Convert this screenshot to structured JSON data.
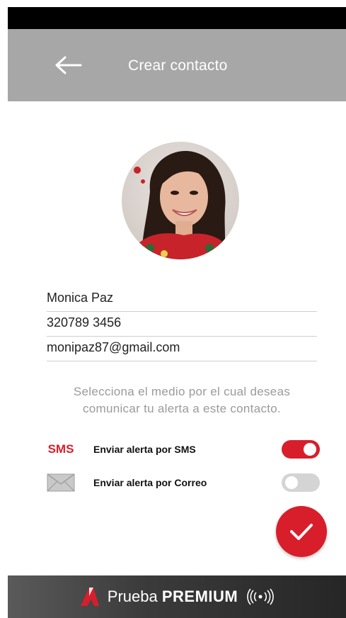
{
  "app_bar": {
    "title": "Crear contacto",
    "back_icon": "arrow-left-icon"
  },
  "contact": {
    "name": "Monica Paz",
    "phone": "320789 3456",
    "email": "monipaz87@gmail.com"
  },
  "instructions": {
    "line1": "Selecciona el medio por el cual deseas",
    "line2": "comunicar tu alerta a este contacto."
  },
  "options": {
    "sms": {
      "icon_label": "SMS",
      "label": "Enviar alerta por SMS",
      "enabled": true
    },
    "email": {
      "icon": "envelope-icon",
      "label": "Enviar alerta por Correo",
      "enabled": false
    }
  },
  "save_button": {
    "icon": "checkmark-icon"
  },
  "premium_banner": {
    "prefix": "Prueba",
    "highlight": "PREMIUM",
    "icons": [
      "brand-logo-icon",
      "signal-icon"
    ]
  },
  "colors": {
    "accent": "#d81e2b",
    "app_bar": "#a7a7a7",
    "toggle_off": "#d4d4d4",
    "status_bar": "#000000"
  }
}
